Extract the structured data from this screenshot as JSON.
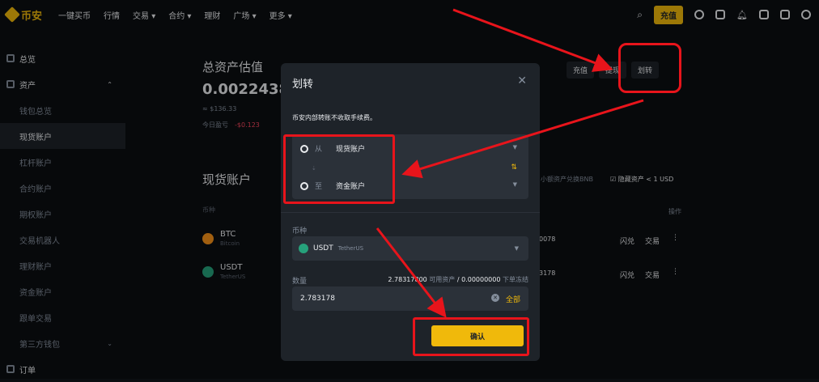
{
  "topbar": {
    "logo": "币安",
    "nav": [
      "一键买币",
      "行情",
      "交易 ▾",
      "合约 ▾",
      "理财",
      "广场 ▾",
      "更多 ▾"
    ],
    "deposit_label": "充值",
    "icons": [
      "search-icon",
      "user-icon",
      "wallet-icon",
      "bell-icon",
      "download-icon",
      "globe-icon",
      "theme-icon"
    ]
  },
  "sidebar": {
    "overview": "总览",
    "assets": "资产",
    "items": [
      "钱包总览",
      "现货账户",
      "杠杆账户",
      "合约账户",
      "期权账户",
      "交易机器人",
      "理财账户",
      "资金账户",
      "跟单交易",
      "第三方钱包"
    ],
    "orders": "订单"
  },
  "main": {
    "est_title": "总资产估值",
    "est_value": "0.0022438",
    "est_usd": "≈ $136.33",
    "pnl_label": "今日盈亏",
    "pnl_value": "-$0.123",
    "spot_title": "现货账户",
    "col_coin": "币种",
    "coins": [
      {
        "symbol": "BTC",
        "name": "Bitcoin",
        "amount": "0078"
      },
      {
        "symbol": "USDT",
        "name": "TetherUS",
        "amount": "3178"
      }
    ],
    "row_actions": [
      "闪兑",
      "交易"
    ],
    "header_buttons": [
      "充值",
      "提现",
      "划转"
    ],
    "small_convert": "小额资产兑换BNB",
    "hide_small": "隐藏资产 < 1 USD",
    "col_action": "操作"
  },
  "modal": {
    "title": "划转",
    "note": "币安内部转账不收取手续费。",
    "from_label": "从",
    "from_value": "现货账户",
    "to_label": "至",
    "to_value": "资金账户",
    "coin_label": "币种",
    "coin_symbol": "USDT",
    "coin_full": "TetherUS",
    "amount_label": "数量",
    "available": "2.78317800",
    "available_suffix": "可用资产",
    "frozen": "/ 0.00000000",
    "frozen_suffix": "下单冻结",
    "amount_value": "2.783178",
    "all_label": "全部",
    "confirm_label": "确认"
  },
  "colors": {
    "accent": "#f0b90b",
    "background": "#0b0e11",
    "panel": "#1e2329",
    "annotation": "#e8141b"
  }
}
